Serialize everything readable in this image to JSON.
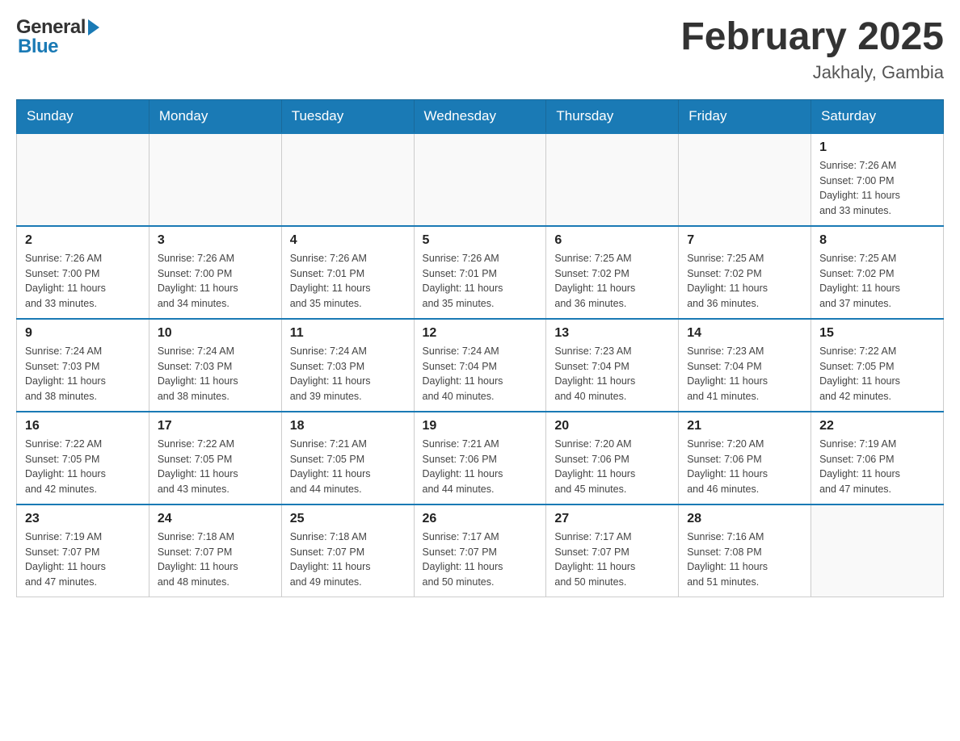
{
  "header": {
    "title": "February 2025",
    "location": "Jakhaly, Gambia",
    "logo_general": "General",
    "logo_blue": "Blue"
  },
  "days_of_week": [
    "Sunday",
    "Monday",
    "Tuesday",
    "Wednesday",
    "Thursday",
    "Friday",
    "Saturday"
  ],
  "weeks": [
    {
      "days": [
        {
          "number": "",
          "info": ""
        },
        {
          "number": "",
          "info": ""
        },
        {
          "number": "",
          "info": ""
        },
        {
          "number": "",
          "info": ""
        },
        {
          "number": "",
          "info": ""
        },
        {
          "number": "",
          "info": ""
        },
        {
          "number": "1",
          "info": "Sunrise: 7:26 AM\nSunset: 7:00 PM\nDaylight: 11 hours\nand 33 minutes."
        }
      ]
    },
    {
      "days": [
        {
          "number": "2",
          "info": "Sunrise: 7:26 AM\nSunset: 7:00 PM\nDaylight: 11 hours\nand 33 minutes."
        },
        {
          "number": "3",
          "info": "Sunrise: 7:26 AM\nSunset: 7:00 PM\nDaylight: 11 hours\nand 34 minutes."
        },
        {
          "number": "4",
          "info": "Sunrise: 7:26 AM\nSunset: 7:01 PM\nDaylight: 11 hours\nand 35 minutes."
        },
        {
          "number": "5",
          "info": "Sunrise: 7:26 AM\nSunset: 7:01 PM\nDaylight: 11 hours\nand 35 minutes."
        },
        {
          "number": "6",
          "info": "Sunrise: 7:25 AM\nSunset: 7:02 PM\nDaylight: 11 hours\nand 36 minutes."
        },
        {
          "number": "7",
          "info": "Sunrise: 7:25 AM\nSunset: 7:02 PM\nDaylight: 11 hours\nand 36 minutes."
        },
        {
          "number": "8",
          "info": "Sunrise: 7:25 AM\nSunset: 7:02 PM\nDaylight: 11 hours\nand 37 minutes."
        }
      ]
    },
    {
      "days": [
        {
          "number": "9",
          "info": "Sunrise: 7:24 AM\nSunset: 7:03 PM\nDaylight: 11 hours\nand 38 minutes."
        },
        {
          "number": "10",
          "info": "Sunrise: 7:24 AM\nSunset: 7:03 PM\nDaylight: 11 hours\nand 38 minutes."
        },
        {
          "number": "11",
          "info": "Sunrise: 7:24 AM\nSunset: 7:03 PM\nDaylight: 11 hours\nand 39 minutes."
        },
        {
          "number": "12",
          "info": "Sunrise: 7:24 AM\nSunset: 7:04 PM\nDaylight: 11 hours\nand 40 minutes."
        },
        {
          "number": "13",
          "info": "Sunrise: 7:23 AM\nSunset: 7:04 PM\nDaylight: 11 hours\nand 40 minutes."
        },
        {
          "number": "14",
          "info": "Sunrise: 7:23 AM\nSunset: 7:04 PM\nDaylight: 11 hours\nand 41 minutes."
        },
        {
          "number": "15",
          "info": "Sunrise: 7:22 AM\nSunset: 7:05 PM\nDaylight: 11 hours\nand 42 minutes."
        }
      ]
    },
    {
      "days": [
        {
          "number": "16",
          "info": "Sunrise: 7:22 AM\nSunset: 7:05 PM\nDaylight: 11 hours\nand 42 minutes."
        },
        {
          "number": "17",
          "info": "Sunrise: 7:22 AM\nSunset: 7:05 PM\nDaylight: 11 hours\nand 43 minutes."
        },
        {
          "number": "18",
          "info": "Sunrise: 7:21 AM\nSunset: 7:05 PM\nDaylight: 11 hours\nand 44 minutes."
        },
        {
          "number": "19",
          "info": "Sunrise: 7:21 AM\nSunset: 7:06 PM\nDaylight: 11 hours\nand 44 minutes."
        },
        {
          "number": "20",
          "info": "Sunrise: 7:20 AM\nSunset: 7:06 PM\nDaylight: 11 hours\nand 45 minutes."
        },
        {
          "number": "21",
          "info": "Sunrise: 7:20 AM\nSunset: 7:06 PM\nDaylight: 11 hours\nand 46 minutes."
        },
        {
          "number": "22",
          "info": "Sunrise: 7:19 AM\nSunset: 7:06 PM\nDaylight: 11 hours\nand 47 minutes."
        }
      ]
    },
    {
      "days": [
        {
          "number": "23",
          "info": "Sunrise: 7:19 AM\nSunset: 7:07 PM\nDaylight: 11 hours\nand 47 minutes."
        },
        {
          "number": "24",
          "info": "Sunrise: 7:18 AM\nSunset: 7:07 PM\nDaylight: 11 hours\nand 48 minutes."
        },
        {
          "number": "25",
          "info": "Sunrise: 7:18 AM\nSunset: 7:07 PM\nDaylight: 11 hours\nand 49 minutes."
        },
        {
          "number": "26",
          "info": "Sunrise: 7:17 AM\nSunset: 7:07 PM\nDaylight: 11 hours\nand 50 minutes."
        },
        {
          "number": "27",
          "info": "Sunrise: 7:17 AM\nSunset: 7:07 PM\nDaylight: 11 hours\nand 50 minutes."
        },
        {
          "number": "28",
          "info": "Sunrise: 7:16 AM\nSunset: 7:08 PM\nDaylight: 11 hours\nand 51 minutes."
        },
        {
          "number": "",
          "info": ""
        }
      ]
    }
  ]
}
